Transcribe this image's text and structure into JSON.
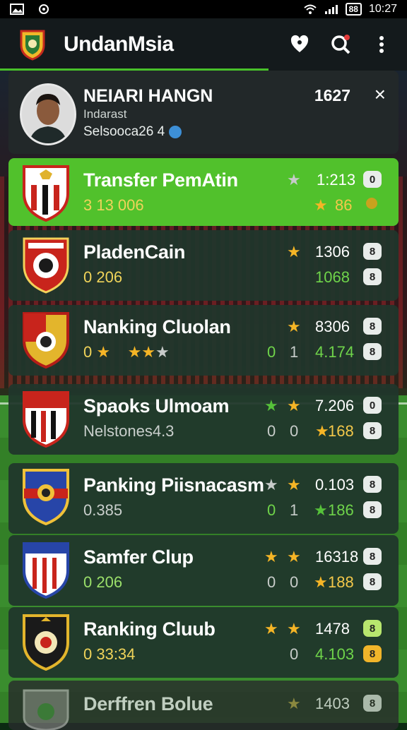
{
  "status_bar": {
    "time": "10:27",
    "battery": "88"
  },
  "app_bar": {
    "title": "UndanMsia",
    "icons": [
      "crest-logo",
      "heart-location-icon",
      "search-icon",
      "more-vertical-icon"
    ]
  },
  "profile": {
    "name": "NEIARI HANGN",
    "subtitle": "Indarast",
    "detail": "Selsooca26 4",
    "code": "1627",
    "close": "×"
  },
  "rows": [
    {
      "name": "Transfer PemAtin",
      "sub": "3 13 006",
      "stat_top": "1:213",
      "stat_bottom": "86",
      "pill_top": "0",
      "pill_bottom": "",
      "highlight": true
    },
    {
      "name": "PladenCain",
      "sub": "0 206",
      "stat_top": "1306",
      "stat_bottom": "1068",
      "pill_top": "8",
      "pill_bottom": "8"
    },
    {
      "name": "Nanking Cluolan",
      "sub": "0",
      "mid_a": "0",
      "mid_b": "1",
      "stat_top": "8306",
      "stat_bottom": "4.174",
      "pill_top": "8",
      "pill_bottom": "8"
    },
    {
      "name": "Spaoks Ulmoam",
      "sub": "Nelstones4.3",
      "mid_a": "0",
      "mid_b": "0",
      "stat_top": "7.206",
      "stat_bottom": "168",
      "pill_top": "0",
      "pill_bottom": "8"
    },
    {
      "name": "Panking Piisnacasm",
      "sub": "0.385",
      "mid_a": "0",
      "mid_b": "1",
      "stat_top": "0.103",
      "stat_bottom": "186",
      "pill_top": "8",
      "pill_bottom": "8"
    },
    {
      "name": "Samfer Clup",
      "sub": "0 206",
      "mid_a": "0",
      "mid_b": "0",
      "stat_top": "16318",
      "stat_bottom": "188",
      "pill_top": "8",
      "pill_bottom": "8"
    },
    {
      "name": "Ranking Cluub",
      "sub": "0 33:34",
      "mid_a": "0",
      "mid_b": "",
      "stat_top": "1478",
      "stat_bottom": "4.103",
      "pill_top": "8",
      "pill_bottom": "8"
    },
    {
      "name": "Derffren Bolue",
      "sub": "",
      "stat_top": "1403",
      "pill_top": "8"
    }
  ],
  "colors": {
    "accent": "#51c12c",
    "card": "#20362c",
    "appbar": "#141a1c"
  }
}
